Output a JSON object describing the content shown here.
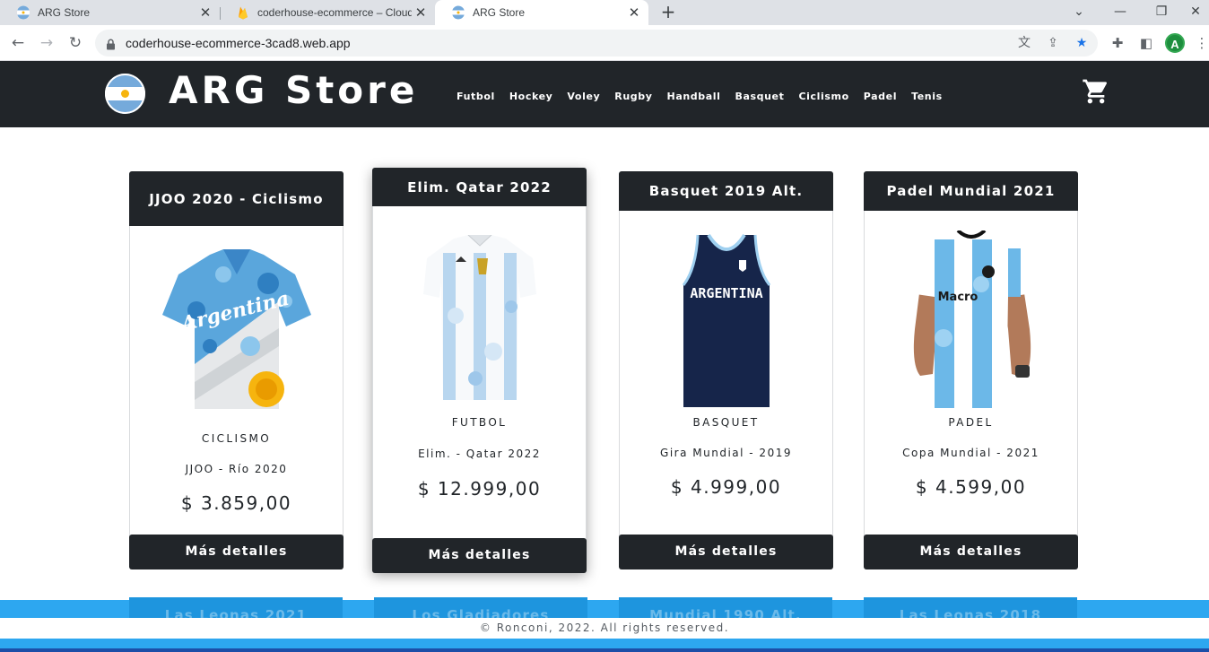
{
  "browser": {
    "tabs": [
      {
        "title": "ARG Store",
        "active": false
      },
      {
        "title": "coderhouse-ecommerce – Cloud",
        "active": false
      },
      {
        "title": "ARG Store",
        "active": true
      }
    ],
    "url": "coderhouse-ecommerce-3cad8.web.app",
    "profile_initial": "A"
  },
  "site": {
    "brand": "ARG Store",
    "nav": [
      "Futbol",
      "Hockey",
      "Voley",
      "Rugby",
      "Handball",
      "Basquet",
      "Ciclismo",
      "Padel",
      "Tenis"
    ]
  },
  "products": [
    {
      "title": "JJOO 2020 - Ciclismo",
      "category": "CICLISMO",
      "name": "JJOO - Río 2020",
      "price": "$ 3.859,00",
      "button": "Más detalles"
    },
    {
      "title": "Elim. Qatar 2022",
      "category": "FUTBOL",
      "name": "Elim. - Qatar 2022",
      "price": "$ 12.999,00",
      "button": "Más detalles"
    },
    {
      "title": "Basquet 2019 Alt.",
      "category": "BASQUET",
      "name": "Gira Mundial - 2019",
      "price": "$ 4.999,00",
      "button": "Más detalles"
    },
    {
      "title": "Padel Mundial 2021",
      "category": "PADEL",
      "name": "Copa Mundial - 2021",
      "price": "$ 4.599,00",
      "button": "Más detalles"
    }
  ],
  "next_row_titles": [
    "Las Leonas 2021",
    "Los Gladiadores",
    "Mundial 1990 Alt.",
    "Las Leonas 2018"
  ],
  "jersey_texts": {
    "basquet": "ARGENTINA",
    "padel": "Macro",
    "ciclismo": "Argentina"
  },
  "footer": "© Ronconi, 2022. All rights reserved.",
  "colors": {
    "header": "#212529",
    "accent": "#2da7f0",
    "celeste": "#75aadb"
  }
}
